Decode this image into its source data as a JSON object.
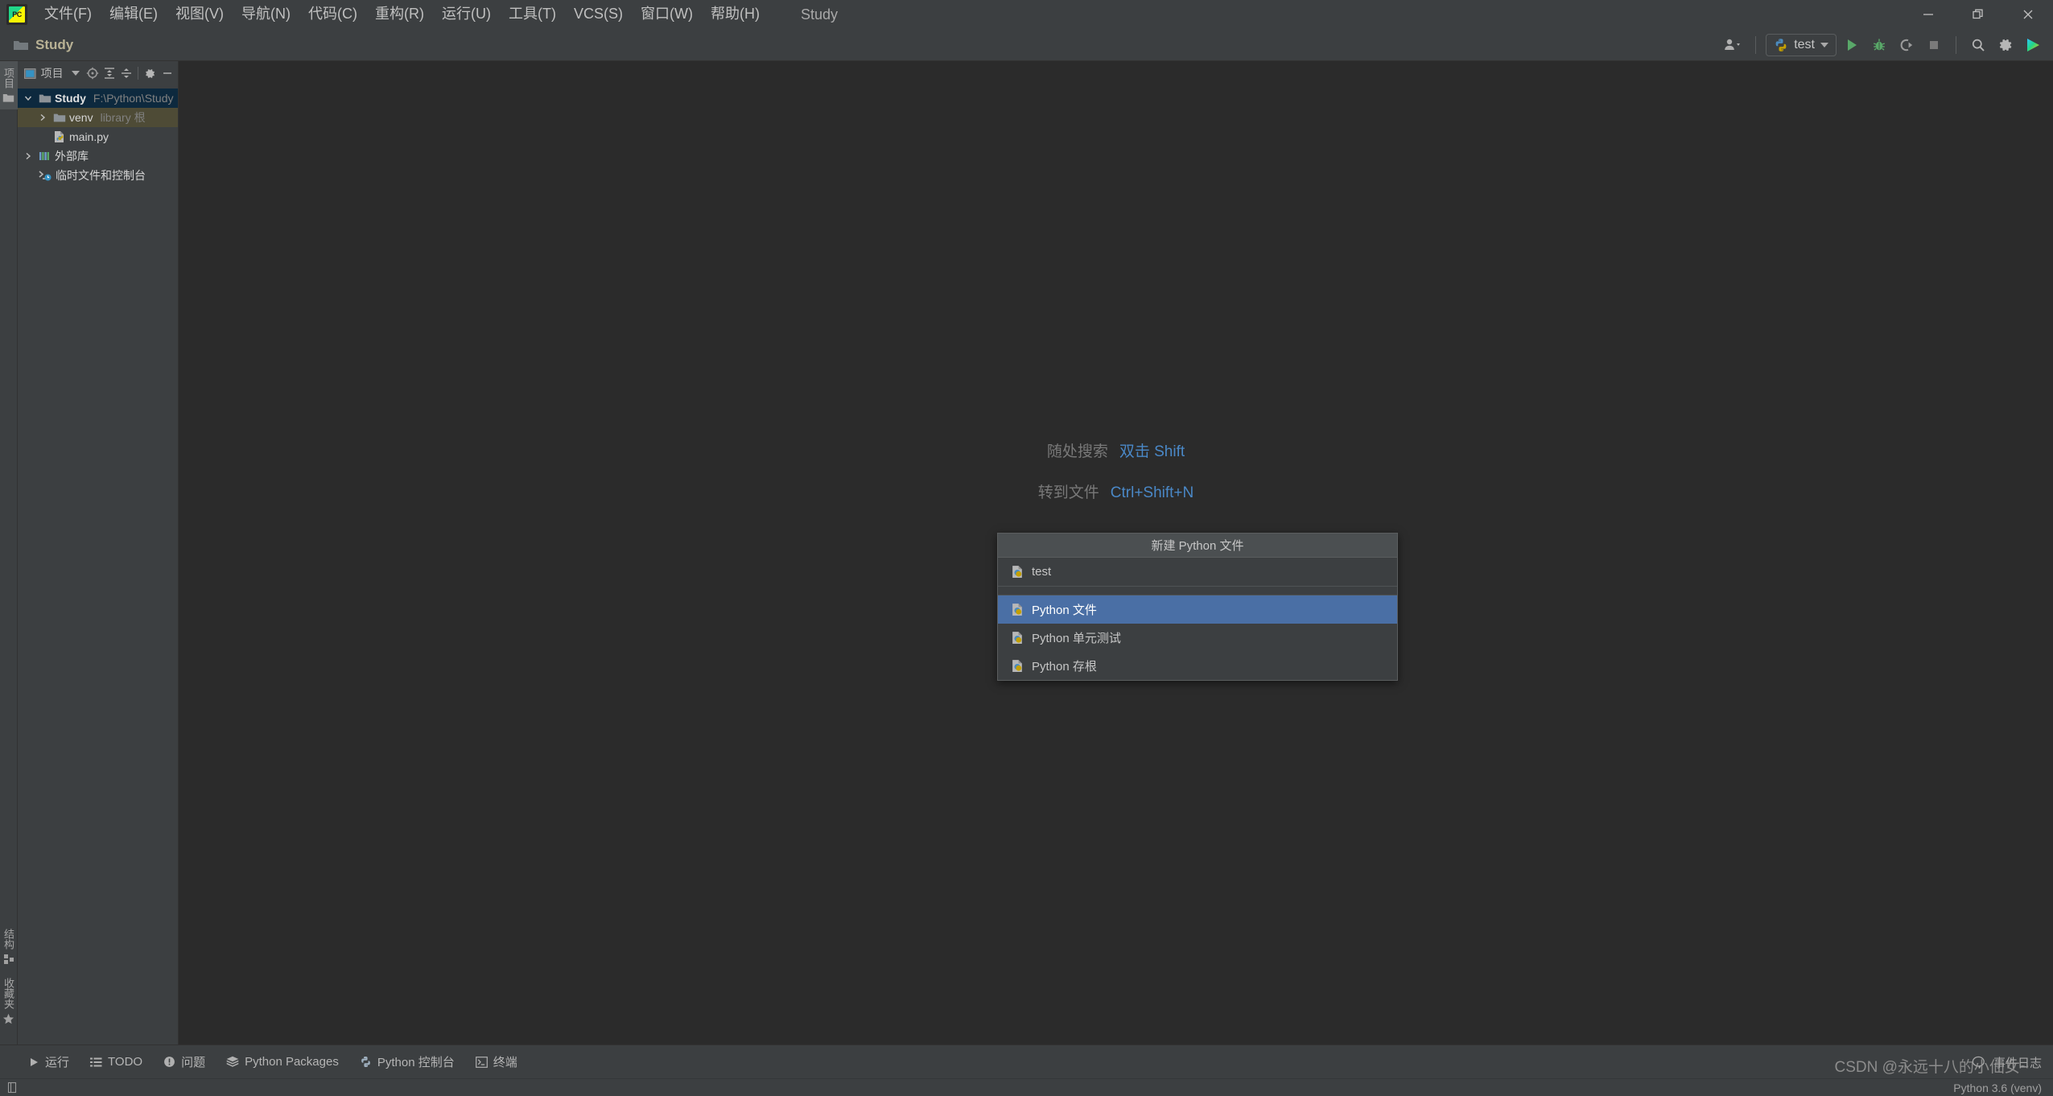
{
  "colors": {
    "panel_bg": "#3c3f41",
    "editor_bg": "#2b2b2b",
    "selection_blue": "#4a6fa5",
    "tree_selected": "#0d293e",
    "tree_hover": "#4e4b36",
    "accent_link": "#4a88c7",
    "breadcrumb_text": "#b9b295"
  },
  "menubar": {
    "logo_text": "PC",
    "items": [
      {
        "label": "文件(F)"
      },
      {
        "label": "编辑(E)"
      },
      {
        "label": "视图(V)"
      },
      {
        "label": "导航(N)"
      },
      {
        "label": "代码(C)"
      },
      {
        "label": "重构(R)"
      },
      {
        "label": "运行(U)"
      },
      {
        "label": "工具(T)"
      },
      {
        "label": "VCS(S)"
      },
      {
        "label": "窗口(W)"
      },
      {
        "label": "帮助(H)"
      }
    ],
    "window_title": "Study",
    "window_controls": {
      "minimize": "minimize-icon",
      "restore": "restore-icon",
      "close": "close-icon"
    }
  },
  "toolbar": {
    "breadcrumb": "Study",
    "breadcrumb_icon": "folder-icon",
    "people_icon": "people-icon",
    "run_config": {
      "label": "test",
      "icon": "python-icon",
      "chevron": "chevron-down-icon"
    },
    "actions": [
      {
        "name": "run-button",
        "icon": "play-icon"
      },
      {
        "name": "debug-button",
        "icon": "bug-icon"
      },
      {
        "name": "run-coverage-button",
        "icon": "coverage-icon"
      },
      {
        "name": "stop-button",
        "icon": "stop-icon"
      },
      {
        "name": "search-everywhere-button",
        "icon": "search-icon"
      },
      {
        "name": "settings-button",
        "icon": "gear-icon"
      },
      {
        "name": "ai-assistant-button",
        "icon": "colorful-play-icon"
      }
    ]
  },
  "left_stripe": {
    "top_tabs": [
      {
        "label": "项目",
        "icon": "folder-icon",
        "active": true
      }
    ],
    "bottom_tabs": [
      {
        "label": "结构",
        "icon": "structure-icon"
      },
      {
        "label": "收藏夹",
        "icon": "star-icon"
      }
    ]
  },
  "project_panel": {
    "title": "项目",
    "title_icon": "project-window-icon",
    "header_buttons": [
      {
        "name": "project-view-dropdown",
        "icon": "chevron-down-icon"
      },
      {
        "name": "scroll-from-source-button",
        "icon": "target-icon"
      },
      {
        "name": "expand-all-button",
        "icon": "expand-all-icon"
      },
      {
        "name": "collapse-all-button",
        "icon": "collapse-all-icon"
      },
      {
        "name": "panel-settings-button",
        "icon": "gear-icon"
      },
      {
        "name": "hide-panel-button",
        "icon": "minimize-icon"
      }
    ],
    "tree": [
      {
        "name": "Study",
        "sub": "F:\\Python\\Study",
        "icon": "folder-icon",
        "arrow": "expanded",
        "indent": 1,
        "state": "selected",
        "bold": true
      },
      {
        "name": "venv",
        "sub": "library 根",
        "icon": "folder-icon",
        "arrow": "collapsed",
        "indent": 2,
        "state": "hovered",
        "bold": false
      },
      {
        "name": "main.py",
        "sub": "",
        "icon": "python-file-icon",
        "arrow": "none",
        "indent": 3,
        "state": "",
        "bold": false
      },
      {
        "name": "外部库",
        "sub": "",
        "icon": "library-icon",
        "arrow": "collapsed",
        "indent": 1,
        "state": "",
        "bold": false
      },
      {
        "name": "临时文件和控制台",
        "sub": "",
        "icon": "scratches-icon",
        "arrow": "none",
        "indent": 1,
        "state": "",
        "bold": false
      }
    ]
  },
  "editor": {
    "hints": [
      {
        "label": "随处搜索",
        "key": "双击 Shift"
      },
      {
        "label": "转到文件",
        "key": "Ctrl+Shift+N"
      }
    ]
  },
  "popup": {
    "title": "新建 Python 文件",
    "input_value": "test",
    "input_icon": "python-file-icon",
    "items": [
      {
        "label": "Python 文件",
        "icon": "python-file-icon",
        "selected": true
      },
      {
        "label": "Python 单元测试",
        "icon": "python-file-icon",
        "selected": false
      },
      {
        "label": "Python 存根",
        "icon": "python-file-icon",
        "selected": false
      }
    ]
  },
  "bottom_bar": {
    "items": [
      {
        "label": "运行",
        "icon": "play-icon"
      },
      {
        "label": "TODO",
        "icon": "list-icon"
      },
      {
        "label": "问题",
        "icon": "warning-icon"
      },
      {
        "label": "Python Packages",
        "icon": "packages-icon"
      },
      {
        "label": "Python 控制台",
        "icon": "python-icon"
      },
      {
        "label": "终端",
        "icon": "terminal-icon"
      }
    ],
    "event_log": {
      "label": "事件日志",
      "icon": "balloon-icon"
    }
  },
  "status_bar": {
    "interpreter": "Python 3.6 (venv)",
    "left_icon": "line-separator-icon"
  },
  "watermark": "CSDN @永远十八的小仙女~"
}
